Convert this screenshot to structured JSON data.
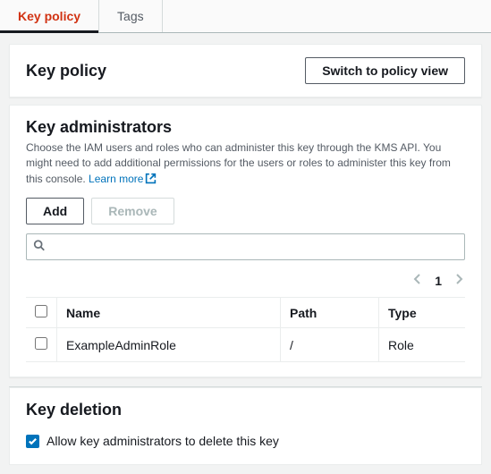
{
  "tabs": {
    "key_policy": "Key policy",
    "tags": "Tags"
  },
  "header": {
    "title": "Key policy",
    "switch_btn": "Switch to policy view"
  },
  "admins": {
    "title": "Key administrators",
    "desc_prefix": "Choose the IAM users and roles who can administer this key through the KMS API. You might need to add additional permissions for the users or roles to administer this key from this console. ",
    "learn_more": "Learn more",
    "add_btn": "Add",
    "remove_btn": "Remove",
    "search_placeholder": "",
    "page": "1",
    "columns": {
      "name": "Name",
      "path": "Path",
      "type": "Type"
    },
    "rows": [
      {
        "name": "ExampleAdminRole",
        "path": "/",
        "type": "Role"
      }
    ]
  },
  "deletion": {
    "title": "Key deletion",
    "checkbox_label": "Allow key administrators to delete this key"
  }
}
